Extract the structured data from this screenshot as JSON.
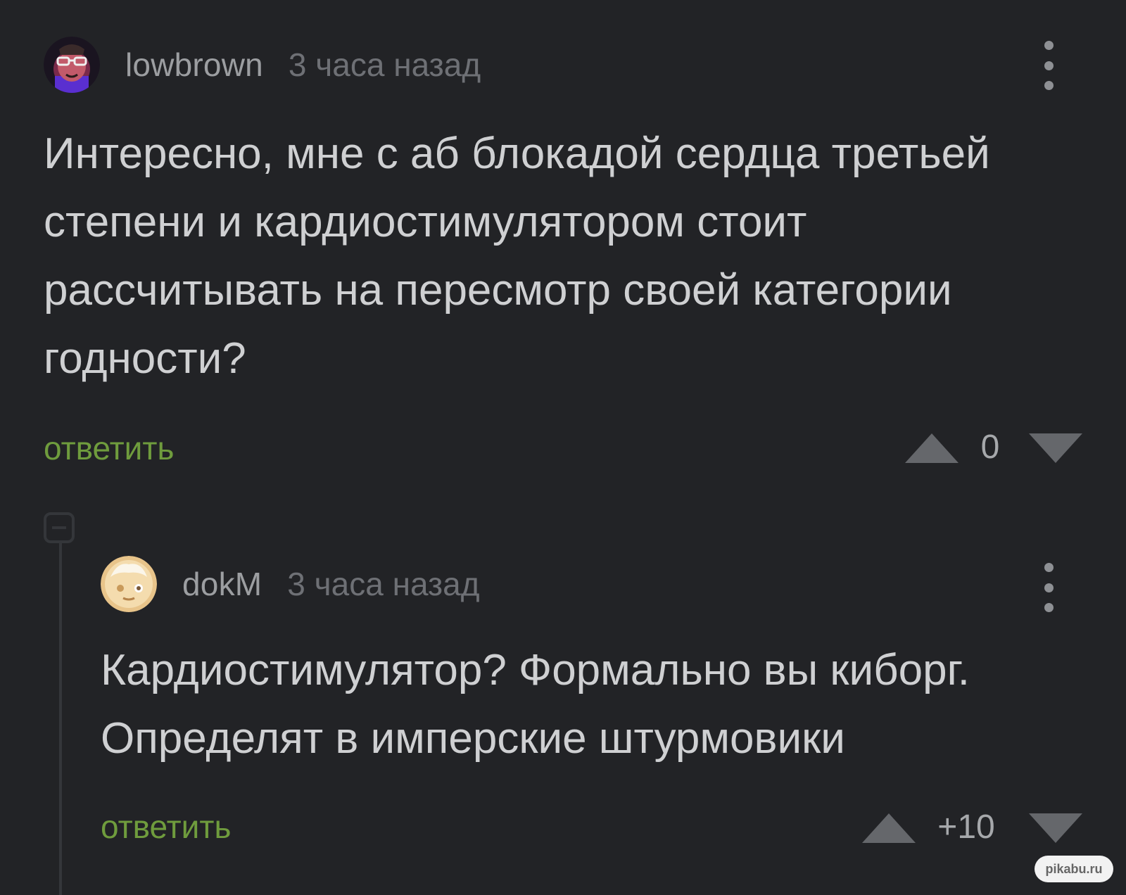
{
  "comments": [
    {
      "username": "lowbrown",
      "time": "3 часа назад",
      "text": "Интересно, мне с аб блокадой сердца третьей степени и кардиостимулятором стоит рассчитывать на пересмотр своей категории годности?",
      "reply_label": "ответить",
      "score": "0"
    },
    {
      "username": "dokM",
      "time": "3 часа назад",
      "text": "Кардиостимулятор? Формально вы киборг. Определят в имперские штурмовики",
      "reply_label": "ответить",
      "score": "+10"
    }
  ],
  "watermark": "pikabu.ru",
  "colors": {
    "background": "#222326",
    "reply_link": "#6f9c3d",
    "text": "#cfd0d2",
    "muted": "#6e7075"
  }
}
